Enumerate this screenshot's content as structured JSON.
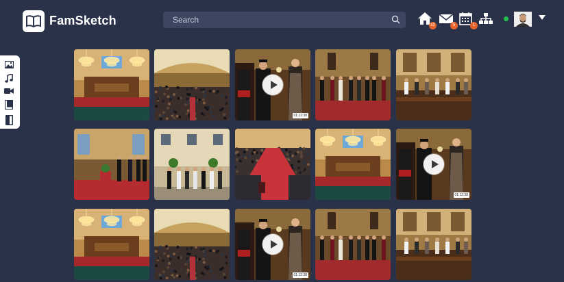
{
  "app": {
    "name": "FamSketch"
  },
  "search": {
    "placeholder": "Search"
  },
  "header": {
    "notifications": [
      {
        "icon": "home-icon",
        "badge": "10"
      },
      {
        "icon": "mail-icon",
        "badge": "5"
      },
      {
        "icon": "calendar-icon",
        "badge": "1"
      },
      {
        "icon": "family-tree-icon"
      }
    ],
    "status_color": "#1fbf4a"
  },
  "sidebar": {
    "items": [
      {
        "icon": "photo-icon"
      },
      {
        "icon": "music-icon"
      },
      {
        "icon": "video-icon"
      },
      {
        "icon": "book-icon"
      },
      {
        "icon": "document-icon"
      }
    ]
  },
  "gallery": {
    "rows": [
      [
        {
          "scene": "chandelier-hall"
        },
        {
          "scene": "crowd-hall"
        },
        {
          "scene": "ceremony-video",
          "duration": "01:12:38"
        },
        {
          "scene": "standing-group"
        },
        {
          "scene": "audience-seated"
        }
      ],
      [
        {
          "scene": "speaker-podium"
        },
        {
          "scene": "courtyard-group"
        },
        {
          "scene": "aisle-hall"
        },
        {
          "scene": "chandelier-hall"
        },
        {
          "scene": "ceremony-video",
          "duration": "01:12:38"
        }
      ],
      [
        {
          "scene": "chandelier-hall"
        },
        {
          "scene": "crowd-hall"
        },
        {
          "scene": "ceremony-video",
          "duration": "01:12:38"
        },
        {
          "scene": "standing-group"
        },
        {
          "scene": "audience-seated"
        }
      ]
    ]
  },
  "colors": {
    "background": "#2a3249",
    "search_bg": "#3d4560",
    "badge": "#e8632a"
  }
}
